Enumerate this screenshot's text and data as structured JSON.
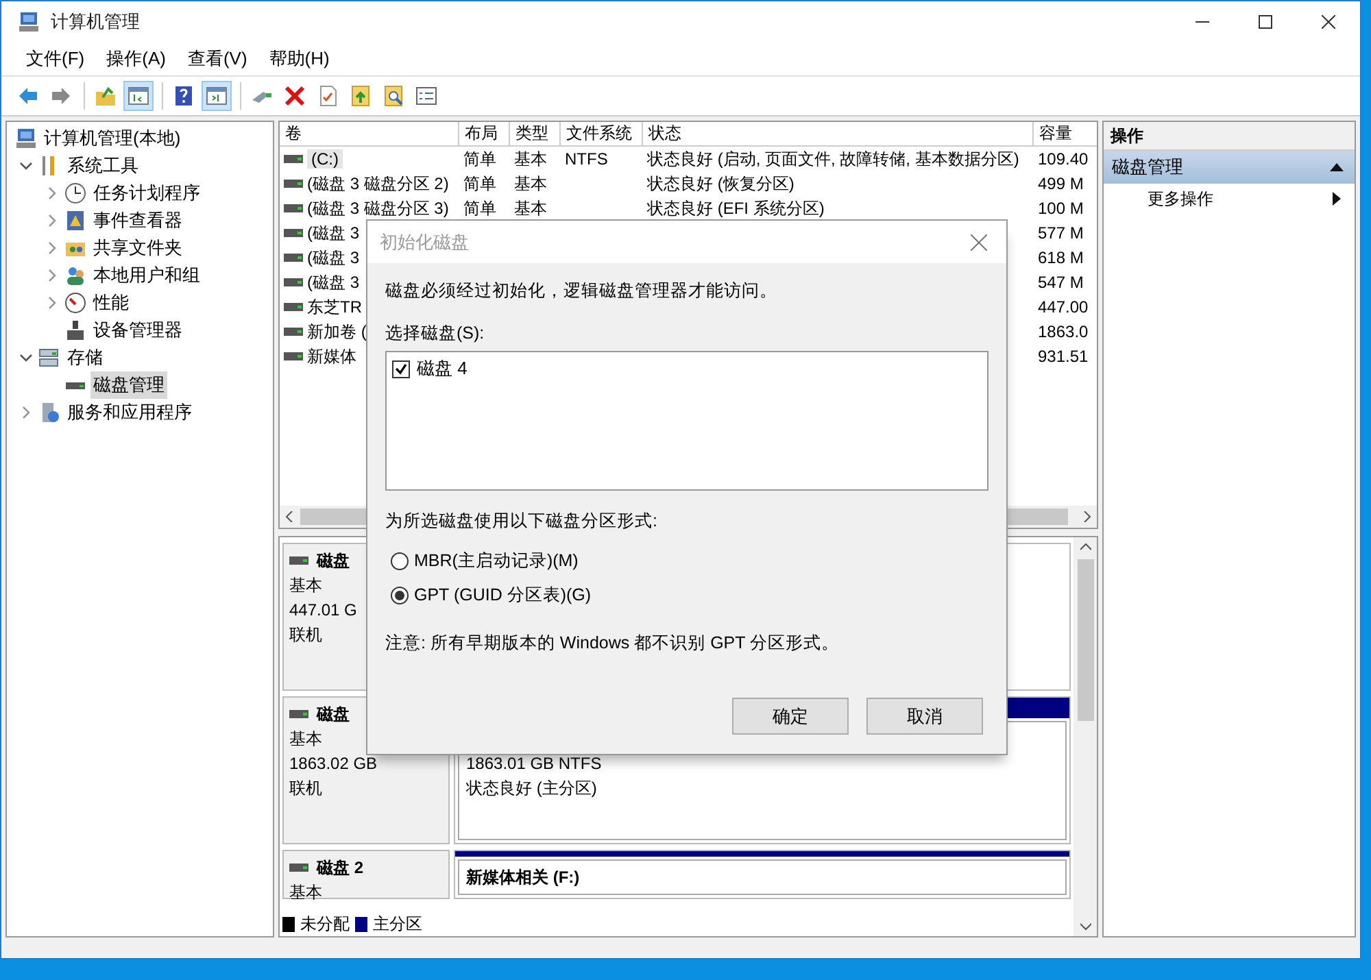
{
  "window": {
    "title": "计算机管理"
  },
  "menu": [
    {
      "label": "文件(F)"
    },
    {
      "label": "操作(A)"
    },
    {
      "label": "查看(V)"
    },
    {
      "label": "帮助(H)"
    }
  ],
  "toolbar": [
    {
      "pressed": false
    },
    {
      "pressed": false
    },
    {
      "pressed": false
    },
    {
      "pressed": true
    },
    {
      "pressed": false
    },
    {
      "pressed": true
    },
    {
      "pressed": false
    },
    {
      "pressed": false
    },
    {
      "pressed": false
    },
    {
      "pressed": false
    },
    {
      "pressed": false
    },
    {
      "pressed": false
    }
  ],
  "tree": [
    {
      "label": "计算机管理(本地)",
      "selected": false,
      "children": [
        {
          "label": "系统工具",
          "expanded": true,
          "selected": false,
          "children": [
            {
              "label": "任务计划程序",
              "expanded": false,
              "selected": false
            },
            {
              "label": "事件查看器",
              "expanded": false,
              "selected": false
            },
            {
              "label": "共享文件夹",
              "expanded": false,
              "selected": false
            },
            {
              "label": "本地用户和组",
              "expanded": false,
              "selected": false
            },
            {
              "label": "性能",
              "expanded": false,
              "selected": false
            },
            {
              "label": "设备管理器",
              "selected": false
            }
          ]
        },
        {
          "label": "存储",
          "expanded": true,
          "selected": false,
          "children": [
            {
              "label": "磁盘管理",
              "selected": true
            }
          ]
        },
        {
          "label": "服务和应用程序",
          "expanded": false,
          "selected": false
        }
      ]
    }
  ],
  "volume_table": {
    "columns": [
      "卷",
      "布局",
      "类型",
      "文件系统",
      "状态",
      "容量"
    ],
    "rows": [
      {
        "cells": [
          "(C:)",
          "简单",
          "基本",
          "NTFS",
          "状态良好 (启动, 页面文件, 故障转储, 基本数据分区)",
          "109.40"
        ],
        "selected": true
      },
      {
        "cells": [
          "(磁盘 3 磁盘分区 2)",
          "简单",
          "基本",
          "",
          "状态良好 (恢复分区)",
          "499 M"
        ],
        "selected": false
      },
      {
        "cells": [
          "(磁盘 3 磁盘分区 3)",
          "简单",
          "基本",
          "",
          "状态良好 (EFI 系统分区)",
          "100 M"
        ],
        "selected": false
      },
      {
        "cells": [
          "(磁盘 3",
          "",
          "",
          "",
          "",
          "577 M"
        ],
        "selected": false
      },
      {
        "cells": [
          "(磁盘 3",
          "",
          "",
          "",
          "",
          "618 M"
        ],
        "selected": false
      },
      {
        "cells": [
          "(磁盘 3",
          "",
          "",
          "",
          "",
          "547 M"
        ],
        "selected": false
      },
      {
        "cells": [
          "东芝TR",
          "",
          "",
          "",
          "",
          "447.00"
        ],
        "selected": false
      },
      {
        "cells": [
          "新加卷 (",
          "",
          "",
          "",
          "",
          "1863.0"
        ],
        "selected": false
      },
      {
        "cells": [
          "新媒体",
          "",
          "",
          "",
          "",
          "931.51"
        ],
        "selected": false
      }
    ]
  },
  "disks": [
    {
      "name": "磁盘",
      "lines": [
        "基本",
        "447.01 G",
        "联机"
      ]
    },
    {
      "name": "磁盘",
      "lines": [
        "基本",
        "1863.02 GB",
        "联机"
      ],
      "partition": {
        "color": "#000080",
        "lines": [
          "1863.01 GB NTFS",
          "状态良好 (主分区)"
        ]
      }
    },
    {
      "name": "磁盘 2",
      "lines": [
        "基本"
      ],
      "partition": {
        "color": "#000080",
        "title": "新媒体相关 (F:)"
      }
    }
  ],
  "legend": [
    {
      "label": "未分配",
      "color": "#000000"
    },
    {
      "label": "主分区",
      "color": "#000080"
    }
  ],
  "actions": {
    "header": "操作",
    "section": {
      "label": "磁盘管理",
      "expanded": true
    },
    "items": [
      {
        "label": "更多操作"
      }
    ]
  },
  "dialog": {
    "title": "初始化磁盘",
    "message": "磁盘必须经过初始化，逻辑磁盘管理器才能访问。",
    "select_label": "选择磁盘(S):",
    "disks": [
      {
        "label": "磁盘 4",
        "checked": true
      }
    ],
    "style_label": "为所选磁盘使用以下磁盘分区形式:",
    "options": [
      {
        "label": "MBR(主启动记录)(M)",
        "selected": false
      },
      {
        "label": "GPT (GUID 分区表)(G)",
        "selected": true
      }
    ],
    "note": "注意: 所有早期版本的 Windows 都不识别 GPT 分区形式。",
    "buttons": [
      "确定",
      "取消"
    ]
  }
}
